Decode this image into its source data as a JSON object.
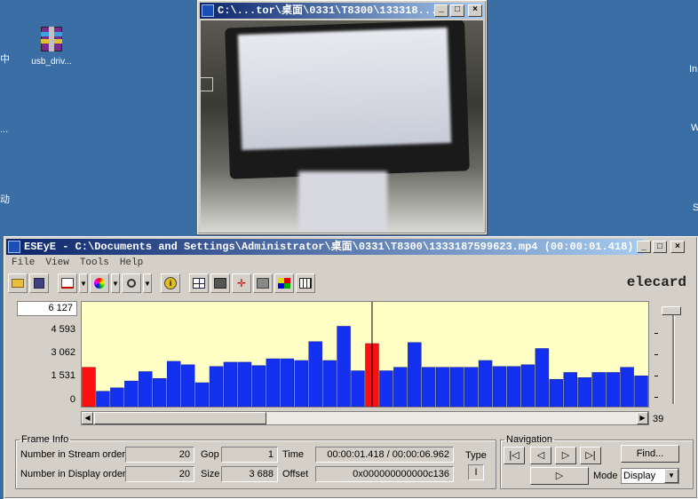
{
  "desktop": {
    "icon_label": "usb_driv...",
    "left_fragments": [
      "中",
      "...",
      "...",
      "动"
    ],
    "right_fragments": [
      "In",
      "W",
      "S"
    ]
  },
  "video_window": {
    "title": "C:\\...tor\\桌面\\0331\\T8300\\133318...",
    "minimize": "_",
    "maximize": "□",
    "close": "×"
  },
  "main_window": {
    "title": "ESEyE - C:\\Documents and Settings\\Administrator\\桌面\\0331\\T8300\\1333187599623.mp4 (00:00:01.418)",
    "minimize": "_",
    "maximize": "□",
    "close": "×",
    "menu": [
      "File",
      "View",
      "Tools",
      "Help"
    ],
    "logo": "elecard"
  },
  "chart": {
    "y_input_value": "6 127",
    "y_labels": [
      "4 593",
      "3 062",
      "1 531",
      "0"
    ],
    "frame_count_label": "39"
  },
  "chart_data": {
    "type": "bar",
    "ylim": [
      0,
      6127
    ],
    "values": [
      2300,
      900,
      1100,
      1500,
      2050,
      1650,
      2650,
      2450,
      1400,
      2350,
      2600,
      2600,
      2400,
      2800,
      2800,
      2700,
      3800,
      2700,
      4700,
      2100,
      3688,
      2100,
      2300,
      3750,
      2300,
      2300,
      2300,
      2300,
      2700,
      2350,
      2350,
      2450,
      3400,
      1600,
      2000,
      1700,
      2000,
      2000,
      2300,
      1800
    ],
    "highlight_indices": [
      0,
      20
    ],
    "colors": {
      "normal": "#1430f0",
      "highlight": "#ff1010",
      "background": "#ffffc6"
    },
    "cursor_index": 20
  },
  "frame_info": {
    "legend": "Frame Info",
    "stream_order_label": "Number in Stream order",
    "stream_order_value": "20",
    "display_order_label": "Number in Display order",
    "display_order_value": "20",
    "gop_label": "Gop",
    "gop_value": "1",
    "size_label": "Size",
    "size_value": "3 688",
    "time_label": "Time",
    "time_value": "00:00:01.418 / 00:00:06.962",
    "offset_label": "Offset",
    "offset_value": "0x000000000000c136",
    "type_label": "Type",
    "type_value": "I"
  },
  "navigation": {
    "legend": "Navigation",
    "find_label": "Find...",
    "mode_label": "Mode",
    "mode_value": "Display"
  }
}
